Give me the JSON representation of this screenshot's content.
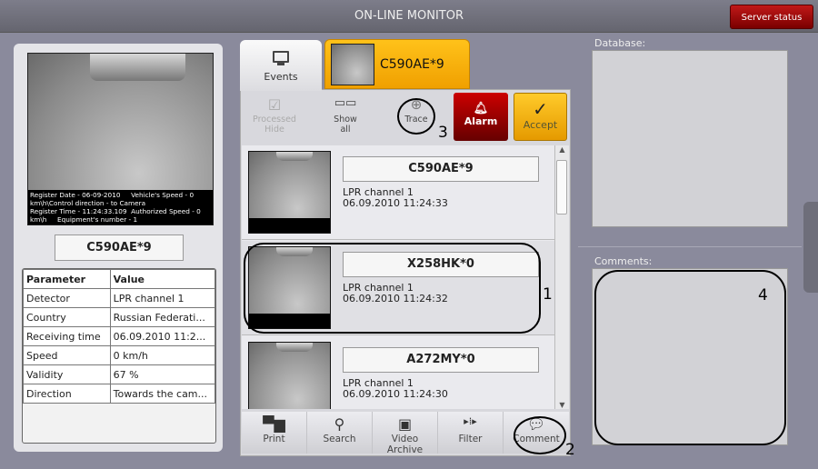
{
  "header": {
    "title": "ON-LINE MONITOR",
    "server_status": "Server status"
  },
  "left": {
    "caption": "Register Date - 06-09-2010     Vehicle's Speed - 0\nkm\\h\\Control direction - to Camera\nRegister Time - 11:24:33.109  Authorized Speed - 0\nkm\\h     Equipment's number - 1",
    "plate": "C590AE*9",
    "table": {
      "headers": [
        "Parameter",
        "Value"
      ],
      "rows": [
        [
          "Detector",
          "LPR channel 1"
        ],
        [
          "Country",
          "Russian Federati..."
        ],
        [
          "Receiving time",
          "06.09.2010 11:2..."
        ],
        [
          "Speed",
          "0 km/h"
        ],
        [
          "Validity",
          "67 %"
        ],
        [
          "Direction",
          "Towards the cam..."
        ]
      ]
    }
  },
  "tabs": {
    "events": "Events",
    "plate": "C590AE*9"
  },
  "toolbar": {
    "processed_hide": [
      "Processed",
      "Hide"
    ],
    "show_all": [
      "Show",
      "all"
    ],
    "trace": "Trace",
    "alarm": "Alarm",
    "accept": "Accept"
  },
  "events": [
    {
      "plate": "C590AE*9",
      "channel": "LPR channel 1",
      "time": "06.09.2010 11:24:33"
    },
    {
      "plate": "X258HK*0",
      "channel": "LPR channel 1",
      "time": "06.09.2010 11:24:32"
    },
    {
      "plate": "A272MY*0",
      "channel": "LPR channel 1",
      "time": "06.09.2010 11:24:30"
    }
  ],
  "bottom": {
    "print": "Print",
    "search": "Search",
    "video_archive": "Video Archive",
    "filter": "Filter",
    "comment": "Comment"
  },
  "right": {
    "database": "Database:",
    "comments": "Comments:"
  },
  "annotations": [
    "1",
    "2",
    "3",
    "4"
  ]
}
